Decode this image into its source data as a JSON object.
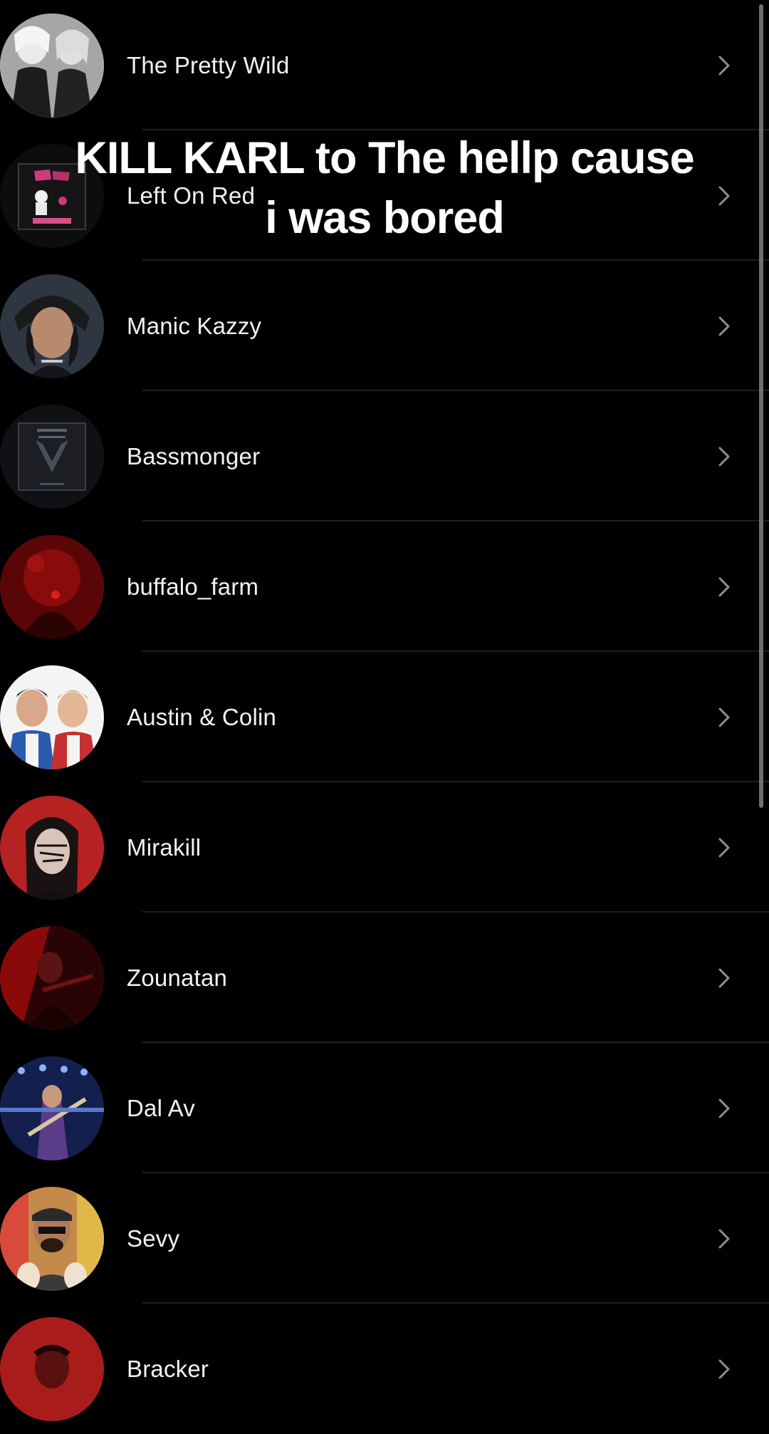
{
  "caption": {
    "line1": "KILL KARL to The hellp cause",
    "line2": "i was bored"
  },
  "rows": [
    {
      "label": "The Pretty Wild",
      "icon": "chevron-right-icon",
      "avatar_color": "#9a9a9a"
    },
    {
      "label": "Left On Red",
      "icon": "chevron-right-icon",
      "avatar_color": "#111111"
    },
    {
      "label": "Manic Kazzy",
      "icon": "chevron-right-icon",
      "avatar_color": "#3b4452"
    },
    {
      "label": "Bassmonger",
      "icon": "chevron-right-icon",
      "avatar_color": "#1a1c22"
    },
    {
      "label": "buffalo_farm",
      "icon": "chevron-right-icon",
      "avatar_color": "#6e0b0b"
    },
    {
      "label": "Austin & Colin",
      "icon": "chevron-right-icon",
      "avatar_color": "#ffffff"
    },
    {
      "label": "Mirakill",
      "icon": "chevron-right-icon",
      "avatar_color": "#b32424"
    },
    {
      "label": "Zounatan",
      "icon": "chevron-right-icon",
      "avatar_color": "#4a0a0a"
    },
    {
      "label": "Dal Av",
      "icon": "chevron-right-icon",
      "avatar_color": "#1c2d6b"
    },
    {
      "label": "Sevy",
      "icon": "chevron-right-icon",
      "avatar_color": "#8a5a3a"
    },
    {
      "label": "Bracker",
      "icon": "chevron-right-icon",
      "avatar_color": "#a81c1c"
    }
  ]
}
